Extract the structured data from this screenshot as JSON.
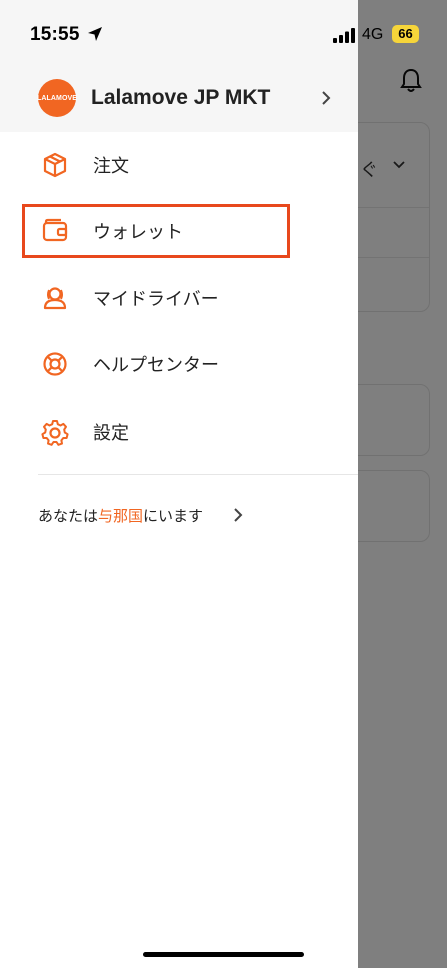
{
  "status_bar": {
    "time": "15:55",
    "network": "4G",
    "battery": "66"
  },
  "profile": {
    "name": "Lalamove JP MKT",
    "avatar_brand": "LALAMOVE"
  },
  "menu": [
    {
      "label": "注文",
      "icon": "box-icon"
    },
    {
      "label": "ウォレット",
      "icon": "wallet-icon"
    },
    {
      "label": "マイドライバー",
      "icon": "drivers-icon"
    },
    {
      "label": "ヘルプセンター",
      "icon": "lifebuoy-icon"
    },
    {
      "label": "設定",
      "icon": "gear-icon"
    }
  ],
  "location": {
    "prefix": "あなたは",
    "place": "与那国",
    "suffix": "にいます"
  },
  "background": {
    "partial_text": "ぐ"
  },
  "colors": {
    "accent": "#f16622",
    "highlight": "#e8481c",
    "overlay": "rgba(0,0,0,0.5)",
    "battery": "#f6d53a"
  }
}
